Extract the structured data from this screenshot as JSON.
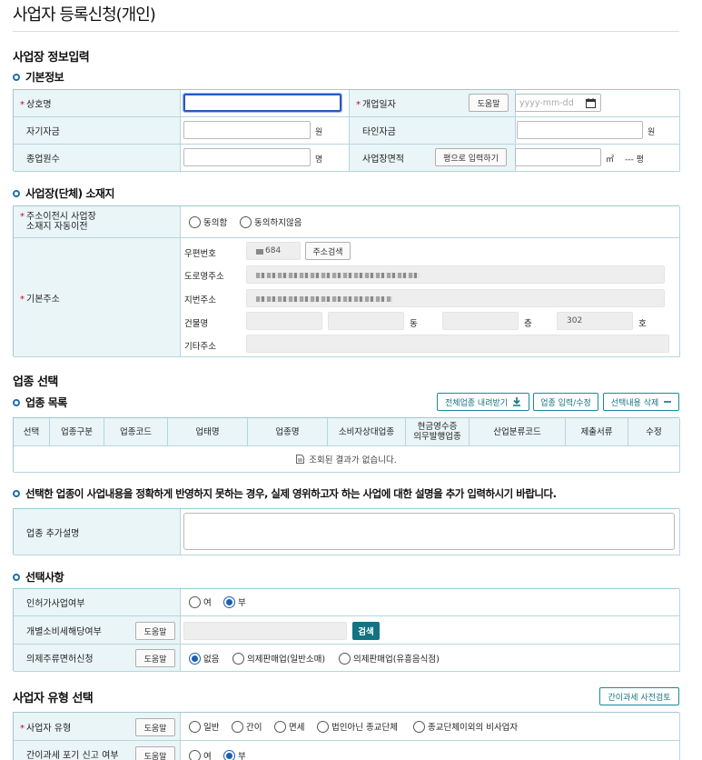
{
  "page": {
    "title": "사업자 등록신청(개인)"
  },
  "sec_info": {
    "heading": "사업장 정보입력",
    "basic": "기본정보",
    "rows": {
      "trade_name": "상호명",
      "open_date": "개업일자",
      "own_capital": "자기자금",
      "other_capital": "타인자금",
      "employees": "종업원수",
      "area": "사업장면적"
    },
    "help": "도움말",
    "date_placeholder": "yyyy-mm-dd",
    "won": "원",
    "persons": "명",
    "area_btn": "평으로 입력하기",
    "sqm": "㎡",
    "pyeong": "--- 평"
  },
  "sec_loc": {
    "heading": "사업장(단체) 소재지",
    "auto_move_l1": "주소이전시 사업장",
    "auto_move_l2": "소재지 자동이전",
    "agree": "동의함",
    "disagree": "동의하지않음",
    "basic_addr": "기본주소",
    "zip": "우편번호",
    "zip_val": "684",
    "zip_btn": "주소검색",
    "road": "도로명주소",
    "jibun": "지번주소",
    "bldg": "건물명",
    "dong": "동",
    "floor": "층",
    "floor_val": "302",
    "ho": "호",
    "etc": "기타주소"
  },
  "sec_biz": {
    "heading": "업종 선택",
    "list": "업종 목록",
    "btn_download": "전체업종 내려받기",
    "btn_edit": "업종 입력/수정",
    "btn_delete": "선택내용 삭제",
    "columns": [
      "선택",
      "업종구분",
      "업종코드",
      "업태명",
      "업종명",
      "소비자상대업종",
      "현금영수증\n의무발행업종",
      "산업분류코드",
      "제출서류",
      "수정"
    ],
    "empty": "조회된 결과가 없습니다.",
    "note": "선택한 업종이 사업내용을 정확하게 반영하지 못하는 경우, 실제 영위하고자 하는 사업에 대한 설명을 추가 입력하시기 바랍니다.",
    "extra_desc": "업종 추가설명"
  },
  "sec_opt": {
    "heading": "선택사항",
    "permit": "인허가사업여부",
    "yes": "여",
    "no": "부",
    "excise": "개별소비세해당여부",
    "search": "검색",
    "liquor": "의제주류면허신청",
    "none": "없음",
    "liquor_a": "의제판매업(일반소매)",
    "liquor_b": "의제판매업(유흥음식점)"
  },
  "sec_type": {
    "heading": "사업자 유형 선택",
    "btn_pre": "간이과세 사전검토",
    "type": "사업자 유형",
    "general": "일반",
    "simple": "간이",
    "exempt": "면세",
    "nonprofit": "법인아닌 종교단체",
    "other": "종교단체이외의 비사업자",
    "giveup": "간이과세 포기 신고 여부",
    "yes": "여",
    "no": "부"
  },
  "colors": {
    "accent": "#127383",
    "label_bg": "#eaf5f7",
    "border": "#b5d6dc",
    "radio": "#1a5fb4"
  }
}
